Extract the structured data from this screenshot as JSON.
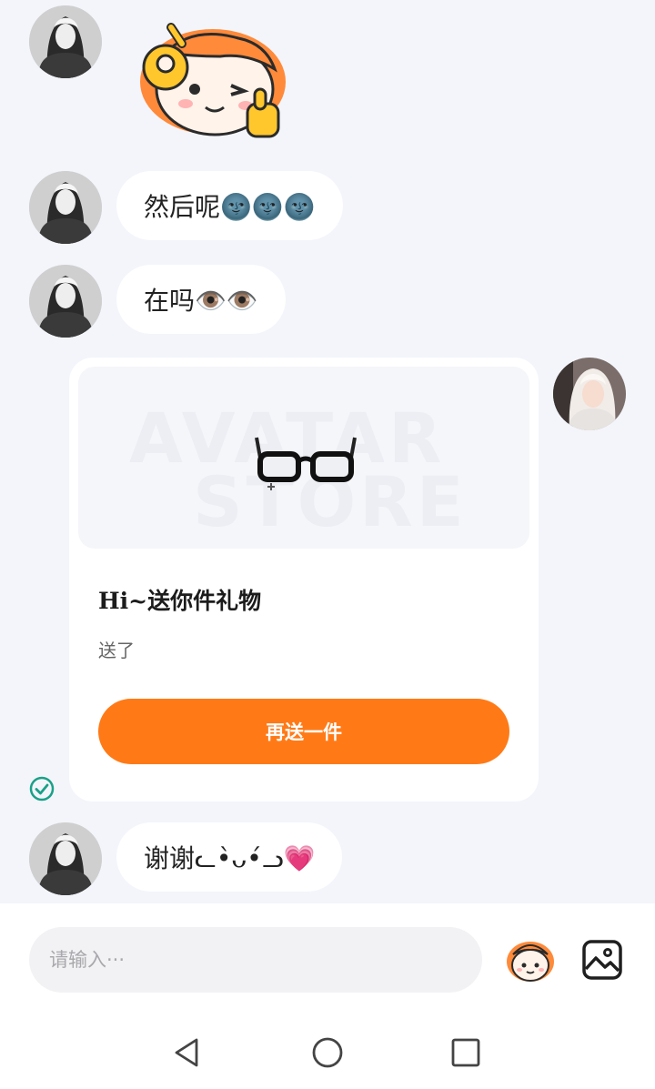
{
  "messages": [
    {
      "sender": "other",
      "type": "sticker",
      "sticker": "ok-thumbs-up-mascot-sticker"
    },
    {
      "sender": "other",
      "type": "text",
      "text": "然后呢🌚🌚🌚"
    },
    {
      "sender": "other",
      "type": "text",
      "text": "在吗👁️👁️"
    },
    {
      "sender": "me",
      "type": "gift",
      "title": "Hi~送你件礼物",
      "subtitle": "送了",
      "button": "再送一件",
      "image": "glasses-icon",
      "watermark": [
        "AVATAR",
        "STORE"
      ],
      "status": "sent-check-icon"
    },
    {
      "sender": "other",
      "type": "text",
      "text": "谢谢ᓚ•̀ᴗ•́ᓗ💗"
    }
  ],
  "composer": {
    "placeholder": "请输入···",
    "value": "",
    "emoji_icon": "mascot-emoji-icon",
    "image_icon": "image-icon"
  },
  "navigation": {
    "back": "back-triangle-icon",
    "home": "home-circle-icon",
    "recents": "recents-square-icon"
  },
  "colors": {
    "background": "#f3f5fa",
    "bubble": "#ffffff",
    "accent": "#ff7a17",
    "check": "#1aa088"
  }
}
